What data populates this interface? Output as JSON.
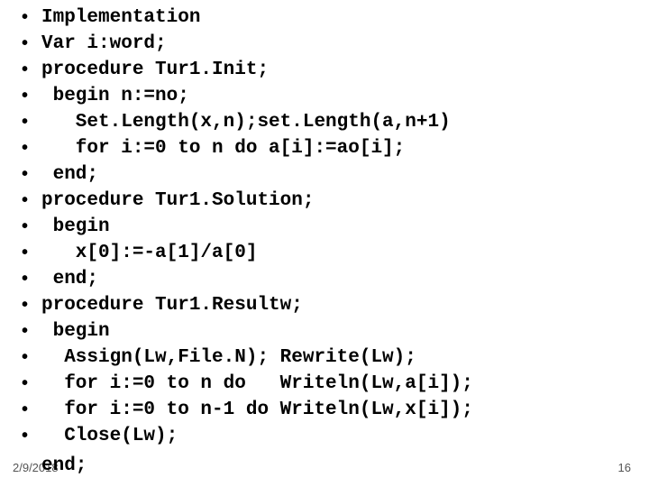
{
  "bullet_char": "•",
  "lines": [
    "Implementation",
    "Var i:word;",
    "procedure Tur1.Init;",
    " begin n:=no;",
    "   Set.Length(x,n);set.Length(a,n+1)",
    "   for i:=0 to n do a[i]:=ao[i];",
    " end;",
    "procedure Tur1.Solution;",
    " begin",
    "   x[0]:=-a[1]/a[0]",
    " end;",
    "procedure Tur1.Resultw;",
    " begin",
    "  Assign(Lw,File.N); Rewrite(Lw);",
    "  for i:=0 to n do   Writeln(Lw,a[i]);",
    "  for i:=0 to n-1 do Writeln(Lw,x[i]);",
    "  Close(Lw);"
  ],
  "last_line": " end;",
  "footer": {
    "date": "2/9/2018",
    "page": "16"
  }
}
